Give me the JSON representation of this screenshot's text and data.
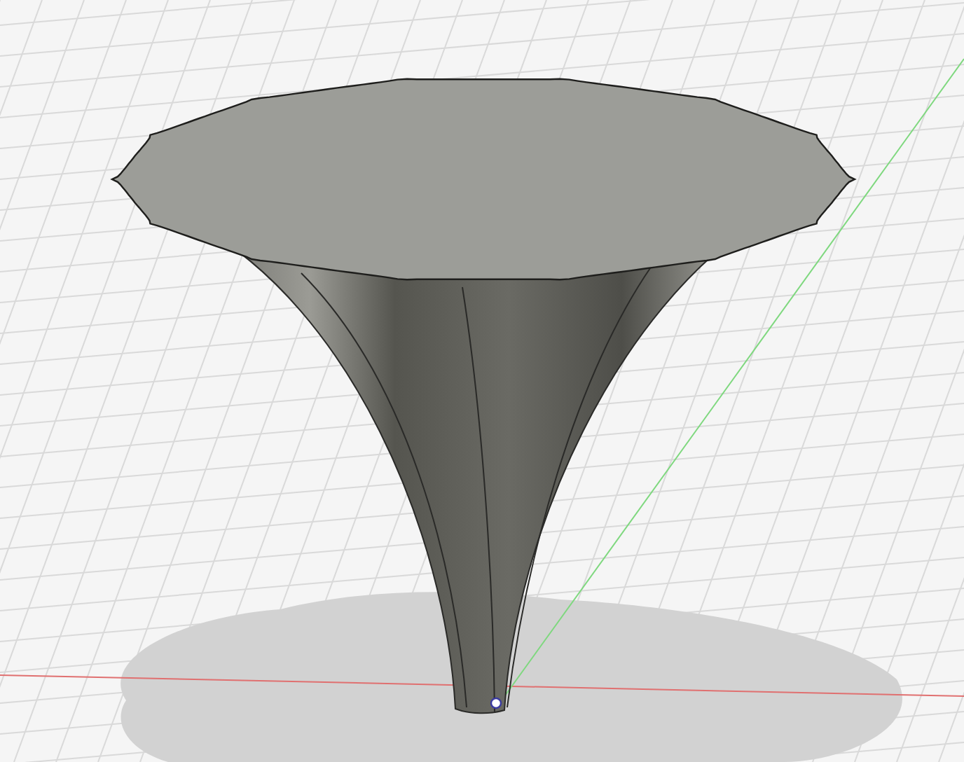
{
  "viewport": {
    "grid": true,
    "axes": true,
    "shadow": true,
    "origin_marker": true
  }
}
